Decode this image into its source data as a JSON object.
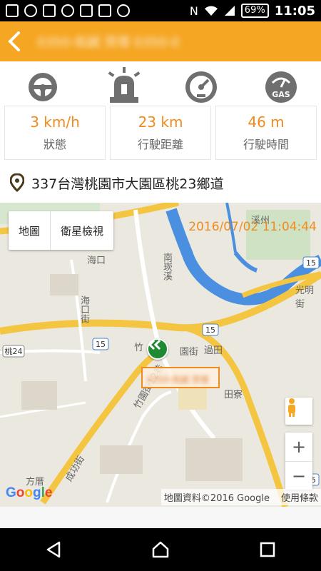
{
  "status_bar": {
    "battery": "69%",
    "time": "11:05"
  },
  "app_bar": {
    "title": "0350-佑誠 货增 0350-0"
  },
  "stats": [
    {
      "icon": "steering-wheel-icon",
      "value": "3 km/h",
      "label": "狀態"
    },
    {
      "icon": "siren-icon",
      "value": "23 km",
      "label": "行駛距離"
    },
    {
      "icon": "speedometer-icon",
      "value": "46 m",
      "label": "行駛時間"
    },
    {
      "icon": "gas-gauge-icon",
      "value": "",
      "label": ""
    }
  ],
  "stat_icon_texts": {
    "gas": "GAS"
  },
  "address": "337台灣桃園市大園區桃23鄉道",
  "map": {
    "type_buttons": [
      "地圖",
      "衛星檢視"
    ],
    "timestamp": "2016/07/02 11:04:44",
    "plate_label": "0350-佑誠 货增",
    "labels": {
      "haikou": "海口",
      "nankankang": "南崁溪",
      "xizhou": "溪州",
      "guangming": "光明街",
      "guotian": "過田",
      "yuanjie": "園街",
      "zhu": "竹",
      "tianliao": "田寮",
      "zhuyuan12": "竹園街12巷",
      "chenggong": "成功街",
      "fangcuo": "方厝",
      "haikoujie": "海口街",
      "tao24": "桃24",
      "route15a": "15",
      "route15b": "15",
      "route15c": "15",
      "route15d": "15"
    },
    "zoom_in": "+",
    "zoom_out": "−",
    "google": "Google",
    "attribution": "地圖資料©2016 Google",
    "terms": "使用條款"
  },
  "colors": {
    "accent": "#f5a623",
    "value_text": "#f08b1d",
    "vehicle": "#1f8a32"
  }
}
